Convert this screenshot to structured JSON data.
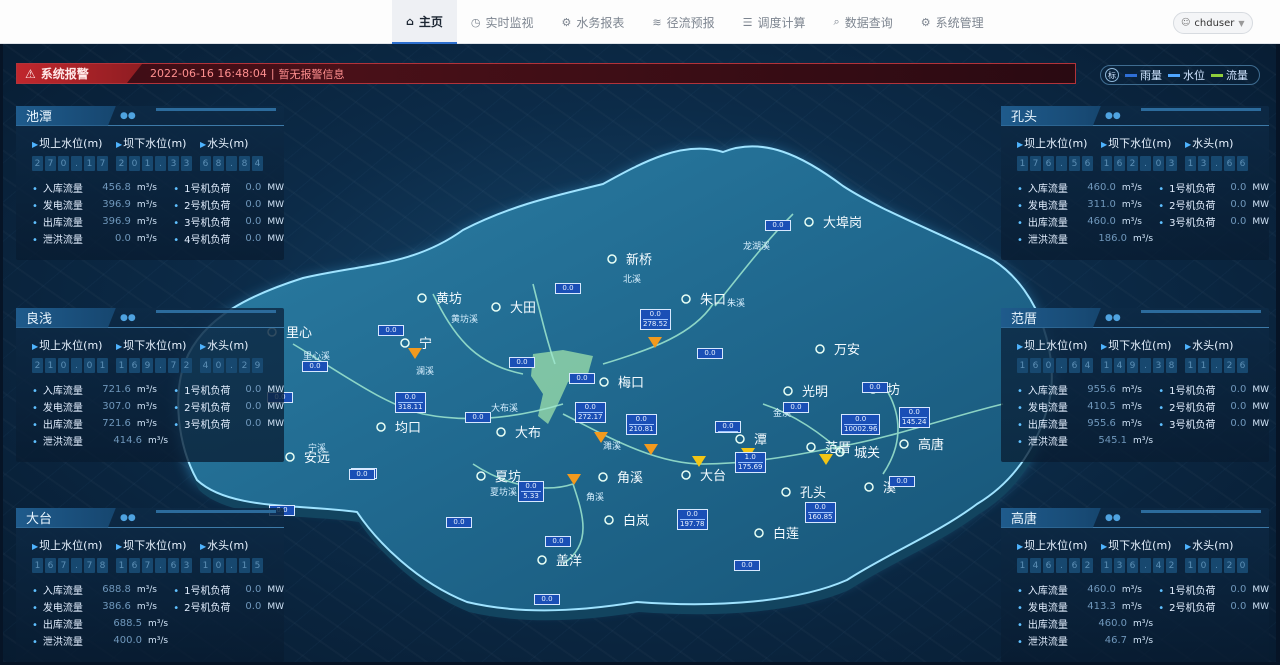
{
  "nav": {
    "items": [
      {
        "label": "主页",
        "icon": "home-icon",
        "glyph": "⌂",
        "active": true
      },
      {
        "label": "实时监视",
        "icon": "monitor-icon",
        "glyph": "◷",
        "active": false
      },
      {
        "label": "水务报表",
        "icon": "report-icon",
        "glyph": "⚙",
        "active": false
      },
      {
        "label": "径流预报",
        "icon": "wave-icon",
        "glyph": "≋",
        "active": false
      },
      {
        "label": "调度计算",
        "icon": "calc-icon",
        "glyph": "☰",
        "active": false
      },
      {
        "label": "数据查询",
        "icon": "search-icon",
        "glyph": "⌕",
        "active": false
      },
      {
        "label": "系统管理",
        "icon": "gear-icon",
        "glyph": "⚙",
        "active": false
      }
    ]
  },
  "user": {
    "name": "chduser"
  },
  "alarm": {
    "title": "系统报警",
    "datetime": "2022-06-16 16:48:04",
    "separator": "|",
    "message": "暂无报警信息"
  },
  "legend": {
    "badge": "标",
    "items": [
      {
        "label": "雨量",
        "color": "#2f6fd6"
      },
      {
        "label": "水位",
        "color": "#4fa6ff"
      },
      {
        "label": "流量",
        "color": "#8fce3c"
      }
    ]
  },
  "panels": [
    {
      "name": "池潭",
      "side": "left",
      "levels": [
        {
          "label": "坝上水位(m)",
          "value": "270.17"
        },
        {
          "label": "坝下水位(m)",
          "value": "201.33"
        },
        {
          "label": "水头(m)",
          "value": "68.84"
        }
      ],
      "rows": [
        {
          "k": "入库流量",
          "v": "456.8",
          "u": "m³/s",
          "k2": "1号机负荷",
          "v2": "0.0",
          "u2": "MW"
        },
        {
          "k": "发电流量",
          "v": "396.9",
          "u": "m³/s",
          "k2": "2号机负荷",
          "v2": "0.0",
          "u2": "MW"
        },
        {
          "k": "出库流量",
          "v": "396.9",
          "u": "m³/s",
          "k2": "3号机负荷",
          "v2": "0.0",
          "u2": "MW"
        },
        {
          "k": "泄洪流量",
          "v": "0.0",
          "u": "m³/s",
          "k2": "4号机负荷",
          "v2": "0.0",
          "u2": "MW"
        }
      ]
    },
    {
      "name": "良浅",
      "side": "left",
      "levels": [
        {
          "label": "坝上水位(m)",
          "value": "210.01"
        },
        {
          "label": "坝下水位(m)",
          "value": "169.72"
        },
        {
          "label": "水头(m)",
          "value": "40.29"
        }
      ],
      "rows": [
        {
          "k": "入库流量",
          "v": "721.6",
          "u": "m³/s",
          "k2": "1号机负荷",
          "v2": "0.0",
          "u2": "MW"
        },
        {
          "k": "发电流量",
          "v": "307.0",
          "u": "m³/s",
          "k2": "2号机负荷",
          "v2": "0.0",
          "u2": "MW"
        },
        {
          "k": "出库流量",
          "v": "721.6",
          "u": "m³/s",
          "k2": "3号机负荷",
          "v2": "0.0",
          "u2": "MW"
        },
        {
          "k": "泄洪流量",
          "v": "414.6",
          "u": "m³/s",
          "k2": "",
          "v2": "",
          "u2": ""
        }
      ]
    },
    {
      "name": "大台",
      "side": "left",
      "levels": [
        {
          "label": "坝上水位(m)",
          "value": "167.78"
        },
        {
          "label": "坝下水位(m)",
          "value": "167.63"
        },
        {
          "label": "水头(m)",
          "value": "10.15"
        }
      ],
      "rows": [
        {
          "k": "入库流量",
          "v": "688.8",
          "u": "m³/s",
          "k2": "1号机负荷",
          "v2": "0.0",
          "u2": "MW"
        },
        {
          "k": "发电流量",
          "v": "386.6",
          "u": "m³/s",
          "k2": "2号机负荷",
          "v2": "0.0",
          "u2": "MW"
        },
        {
          "k": "出库流量",
          "v": "688.5",
          "u": "m³/s",
          "k2": "",
          "v2": "",
          "u2": ""
        },
        {
          "k": "泄洪流量",
          "v": "400.0",
          "u": "m³/s",
          "k2": "",
          "v2": "",
          "u2": ""
        }
      ]
    },
    {
      "name": "孔头",
      "side": "right",
      "levels": [
        {
          "label": "坝上水位(m)",
          "value": "176.56"
        },
        {
          "label": "坝下水位(m)",
          "value": "162.03"
        },
        {
          "label": "水头(m)",
          "value": "13.66"
        }
      ],
      "rows": [
        {
          "k": "入库流量",
          "v": "460.0",
          "u": "m³/s",
          "k2": "1号机负荷",
          "v2": "0.0",
          "u2": "MW"
        },
        {
          "k": "发电流量",
          "v": "311.0",
          "u": "m³/s",
          "k2": "2号机负荷",
          "v2": "0.0",
          "u2": "MW"
        },
        {
          "k": "出库流量",
          "v": "460.0",
          "u": "m³/s",
          "k2": "3号机负荷",
          "v2": "0.0",
          "u2": "MW"
        },
        {
          "k": "泄洪流量",
          "v": "186.0",
          "u": "m³/s",
          "k2": "",
          "v2": "",
          "u2": ""
        }
      ]
    },
    {
      "name": "范厝",
      "side": "right",
      "levels": [
        {
          "label": "坝上水位(m)",
          "value": "160.64"
        },
        {
          "label": "坝下水位(m)",
          "value": "149.38"
        },
        {
          "label": "水头(m)",
          "value": "11.26"
        }
      ],
      "rows": [
        {
          "k": "入库流量",
          "v": "955.6",
          "u": "m³/s",
          "k2": "1号机负荷",
          "v2": "0.0",
          "u2": "MW"
        },
        {
          "k": "发电流量",
          "v": "410.5",
          "u": "m³/s",
          "k2": "2号机负荷",
          "v2": "0.0",
          "u2": "MW"
        },
        {
          "k": "出库流量",
          "v": "955.6",
          "u": "m³/s",
          "k2": "3号机负荷",
          "v2": "0.0",
          "u2": "MW"
        },
        {
          "k": "泄洪流量",
          "v": "545.1",
          "u": "m³/s",
          "k2": "",
          "v2": "",
          "u2": ""
        }
      ]
    },
    {
      "name": "高唐",
      "side": "right",
      "levels": [
        {
          "label": "坝上水位(m)",
          "value": "146.62"
        },
        {
          "label": "坝下水位(m)",
          "value": "136.42"
        },
        {
          "label": "水头(m)",
          "value": "10.20"
        }
      ],
      "rows": [
        {
          "k": "入库流量",
          "v": "460.0",
          "u": "m³/s",
          "k2": "1号机负荷",
          "v2": "0.0",
          "u2": "MW"
        },
        {
          "k": "发电流量",
          "v": "413.3",
          "u": "m³/s",
          "k2": "2号机负荷",
          "v2": "0.0",
          "u2": "MW"
        },
        {
          "k": "出库流量",
          "v": "460.0",
          "u": "m³/s",
          "k2": "",
          "v2": "",
          "u2": ""
        },
        {
          "k": "泄洪流量",
          "v": "46.7",
          "u": "m³/s",
          "k2": "",
          "v2": "",
          "u2": ""
        }
      ]
    }
  ],
  "map": {
    "places": [
      "大埠岗",
      "新桥",
      "朱口",
      "大田",
      "黄坊",
      "里心",
      "宁",
      "梅口",
      "万安",
      "光明",
      "范厝",
      "坊",
      "高唐",
      "城关",
      "均口",
      "大布",
      "安远",
      "夏坊",
      "角溪",
      "白岚",
      "大台",
      "潭",
      "孔头",
      "白莲",
      "溪",
      "盖洋"
    ],
    "rivers": [
      "龙湖溪",
      "北溪",
      "朱溪",
      "大布溪",
      "澜溪",
      "黄坊溪",
      "里心溪",
      "宁溪",
      "濉溪",
      "金溪",
      "夏坊溪",
      "角溪"
    ],
    "tags": [
      {
        "id": "t-dabugang",
        "lines": [
          "0.0"
        ]
      },
      {
        "id": "t-datian",
        "lines": [
          "0.0"
        ]
      },
      {
        "id": "t-zhukou",
        "lines": [
          "0.0",
          "278.52"
        ]
      },
      {
        "id": "t-ning",
        "lines": [
          "0.0"
        ]
      },
      {
        "id": "t-lixin",
        "lines": [
          "0.0"
        ]
      },
      {
        "id": "t-zhukou2",
        "lines": [
          "0.0"
        ]
      },
      {
        "id": "t-meikou1",
        "lines": [
          "0.0"
        ]
      },
      {
        "id": "t-meikou2",
        "lines": [
          "0.0"
        ]
      },
      {
        "id": "t-liangqian",
        "lines": [
          "0.0"
        ]
      },
      {
        "id": "t-junkou",
        "lines": [
          "0.0",
          "318.11"
        ]
      },
      {
        "id": "t-dabu",
        "lines": [
          "0.0"
        ]
      },
      {
        "id": "t-chitan",
        "lines": [
          "0.0",
          "272.17"
        ]
      },
      {
        "id": "t-jiaoxi",
        "lines": [
          "0.0",
          "210.81"
        ]
      },
      {
        "id": "t-anyuan",
        "lines": [
          "0.0"
        ]
      },
      {
        "id": "t-xiafang",
        "lines": [
          "0.0",
          "5.33"
        ]
      },
      {
        "id": "t-baitai",
        "lines": [
          "0.0"
        ]
      },
      {
        "id": "t-dongtai1",
        "lines": [
          "0.0"
        ]
      },
      {
        "id": "t-gaiyang",
        "lines": [
          "0.0"
        ]
      },
      {
        "id": "t-tan",
        "lines": [
          "0.0",
          ""
        ]
      },
      {
        "id": "t-kongtou",
        "lines": [
          "1.0",
          "175.69"
        ]
      },
      {
        "id": "t-daTai",
        "lines": [
          "0.0",
          "197.78"
        ]
      },
      {
        "id": "t-guangming",
        "lines": [
          "0.0"
        ]
      },
      {
        "id": "t-fancuo",
        "lines": [
          "0.0",
          "10002.96"
        ]
      },
      {
        "id": "t-wanan",
        "lines": [
          "0.0"
        ]
      },
      {
        "id": "t-gaotang",
        "lines": [
          "0.0",
          "145.24"
        ]
      },
      {
        "id": "t-xi",
        "lines": [
          "0.0"
        ]
      },
      {
        "id": "t-bailian",
        "lines": [
          "0.0",
          "160.85"
        ]
      },
      {
        "id": "t-south",
        "lines": [
          "0.0"
        ]
      },
      {
        "id": "t-south2",
        "lines": [
          "0.0"
        ]
      },
      {
        "id": "t-west",
        "lines": [
          "0.0"
        ]
      }
    ]
  }
}
